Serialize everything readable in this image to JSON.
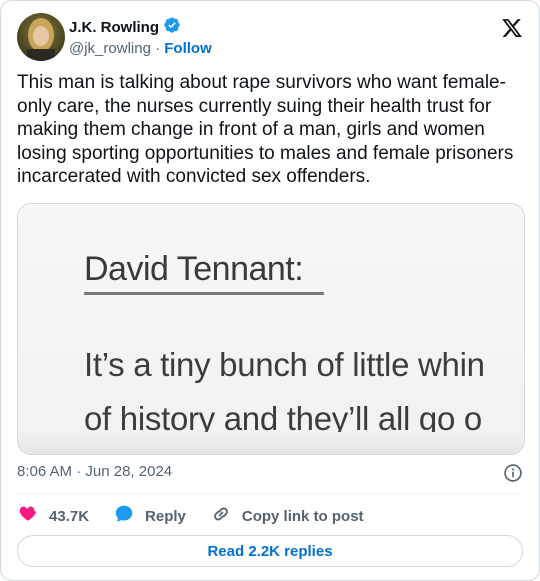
{
  "author": {
    "name": "J.K. Rowling",
    "handle": "@jk_rowling",
    "separator": "·",
    "follow_label": "Follow",
    "verified_color": "#1d9bf0"
  },
  "tweet": {
    "text": "This man is talking about rape survivors who want female-only care, the nurses currently suing their health trust for making them change in front of a man, girls and women losing sporting opportunities to males and female prisoners incarcerated with convicted sex offenders."
  },
  "media": {
    "heading": "David Tennant:",
    "quote_line_1": "It’s a tiny bunch of little whin",
    "quote_line_2": "of history and they’ll all go o"
  },
  "meta": {
    "time": "8:06 AM",
    "separator": "·",
    "date": "Jun 28, 2024"
  },
  "actions": {
    "likes": "43.7K",
    "reply_label": "Reply",
    "copy_label": "Copy link to post",
    "heart_color": "#f91880",
    "reply_color": "#1d9bf0"
  },
  "footer": {
    "read_replies_label": "Read 2.2K replies"
  },
  "icons": [
    "verified-badge-icon",
    "x-logo-icon",
    "info-icon",
    "heart-icon",
    "reply-bubble-icon",
    "link-icon"
  ]
}
